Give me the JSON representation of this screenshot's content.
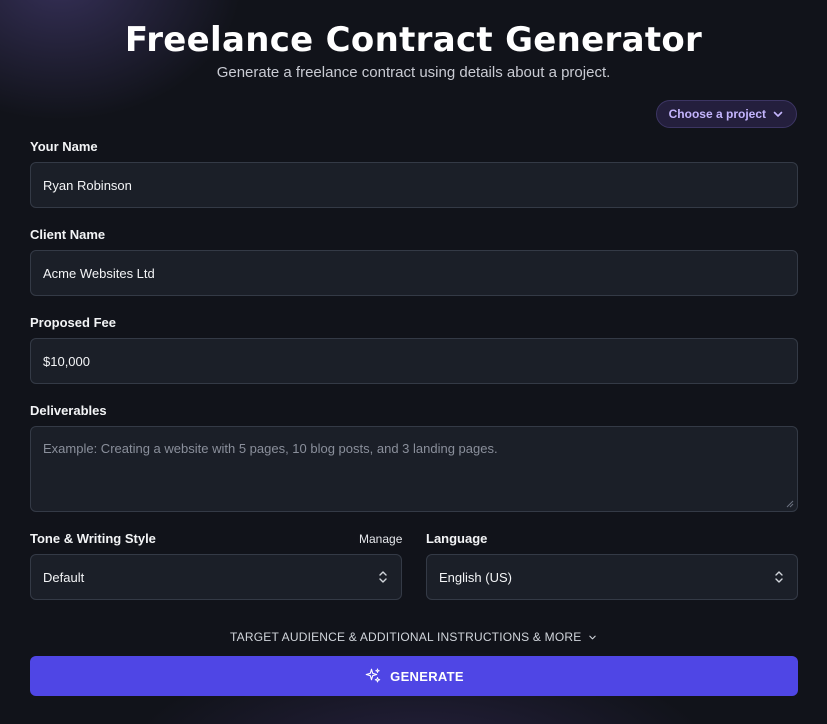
{
  "header": {
    "title": "Freelance Contract Generator",
    "subtitle": "Generate a freelance contract using details about a project."
  },
  "project_button": {
    "label": "Choose a project",
    "icon": "chevron-down-icon"
  },
  "form": {
    "your_name": {
      "label": "Your Name",
      "value": "Ryan Robinson"
    },
    "client_name": {
      "label": "Client Name",
      "value": "Acme Websites Ltd"
    },
    "proposed_fee": {
      "label": "Proposed Fee",
      "value": "$10,000"
    },
    "deliverables": {
      "label": "Deliverables",
      "value": "",
      "placeholder": "Example: Creating a website with 5 pages, 10 blog posts, and 3 landing pages."
    },
    "tone": {
      "label": "Tone & Writing Style",
      "manage_label": "Manage",
      "value": "Default"
    },
    "language": {
      "label": "Language",
      "value": "English (US)"
    }
  },
  "more_options": {
    "label": "TARGET AUDIENCE & ADDITIONAL INSTRUCTIONS & MORE",
    "icon": "chevron-down-icon"
  },
  "generate": {
    "label": "GENERATE",
    "icon": "sparkles-icon"
  },
  "colors": {
    "background": "#11131a",
    "accent": "#4f46e5",
    "field_bg": "#1b1f28",
    "field_border": "#343a46",
    "project_chip": "#c4b5fd"
  }
}
